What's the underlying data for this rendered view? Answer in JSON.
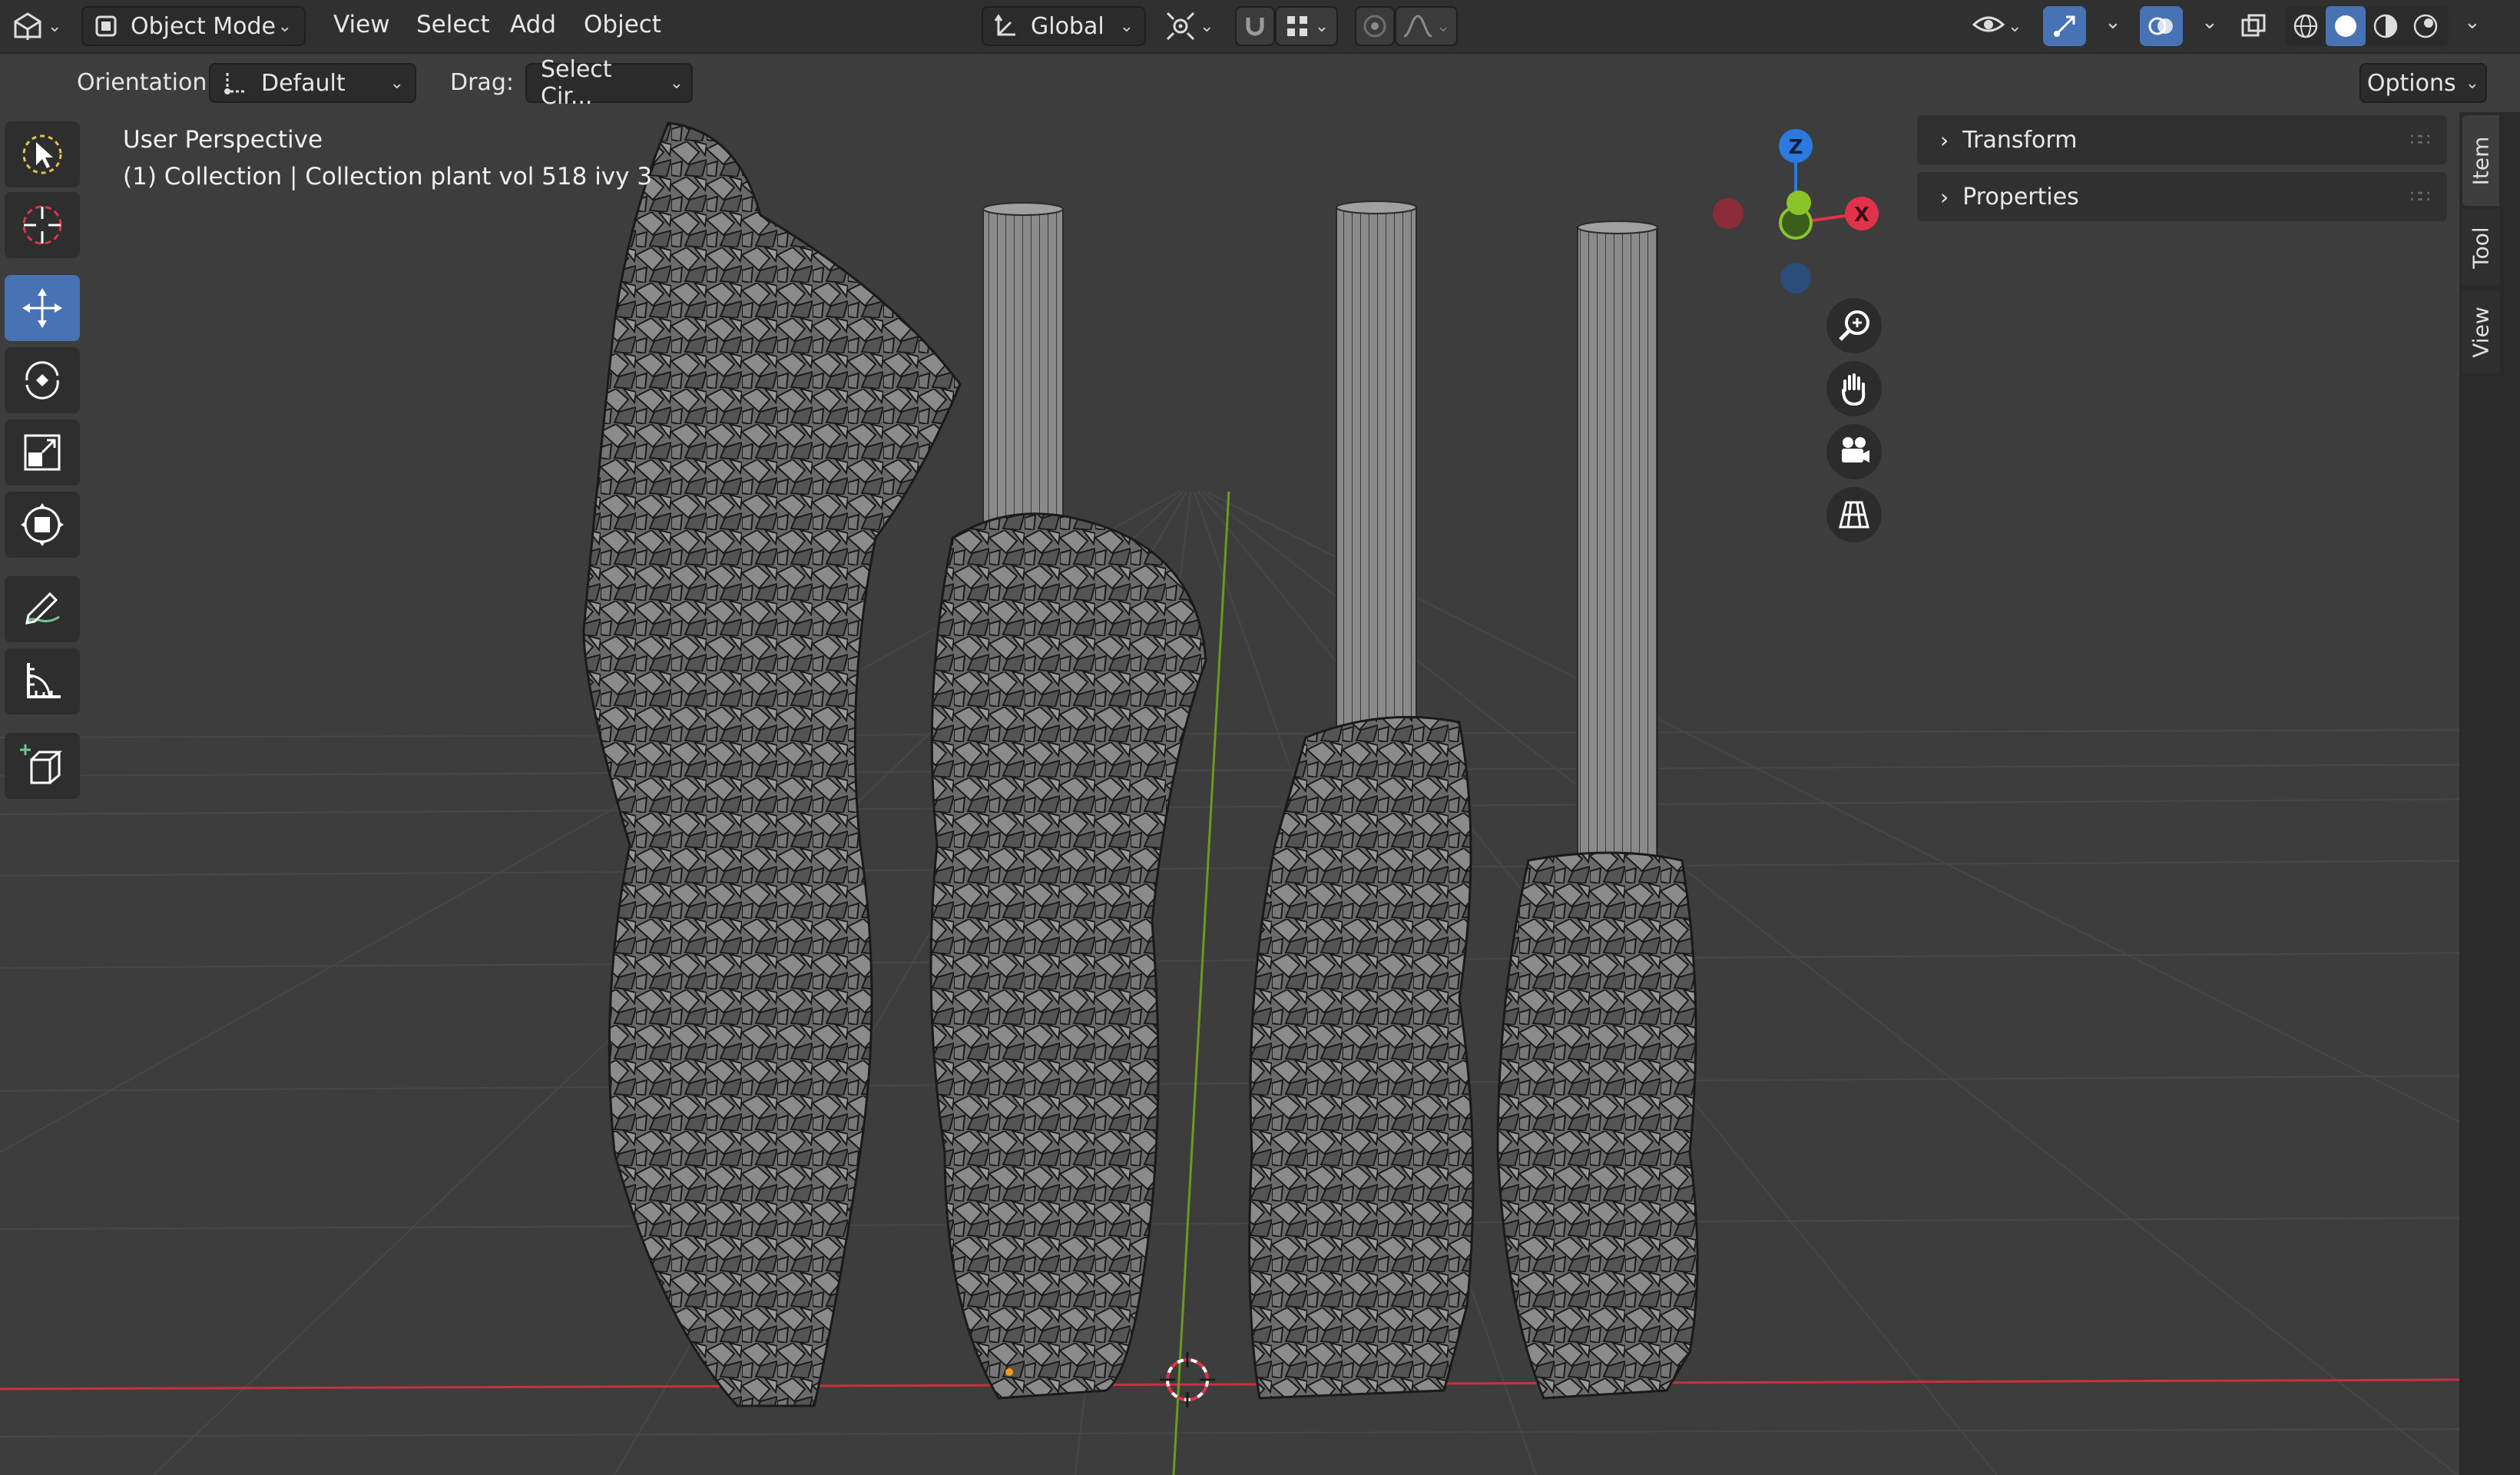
{
  "header": {
    "editor_type_icon": "3d-viewport-icon",
    "mode": {
      "label": "Object Mode",
      "icon": "object-mode-icon"
    },
    "menus": [
      "View",
      "Select",
      "Add",
      "Object"
    ],
    "transform_orientation": {
      "label": "Global",
      "icon": "transform-orientation-icon"
    },
    "pivot_icon": "pivot-point-icon",
    "snap_icon": "magnet-icon",
    "snap_target_icon": "snap-grid-icon",
    "proportional_icon": "proportional-edit-icon",
    "falloff_icon": "falloff-curve-icon",
    "visibility_icon": "eye-visibility-icon",
    "gizmo_icon": "gizmo-icon",
    "overlay_icon": "overlay-icon",
    "xray_icon": "xray-icon",
    "shading_modes": [
      "wireframe",
      "solid",
      "material-preview",
      "rendered"
    ],
    "active_shading": "solid"
  },
  "tool_header": {
    "orientation_label": "Orientation:",
    "orientation_value": "Default",
    "drag_label": "Drag:",
    "drag_value": "Select Cir...",
    "options_label": "Options"
  },
  "toolbar": {
    "tools": [
      {
        "name": "select-box-tool",
        "active": false
      },
      {
        "name": "cursor-tool",
        "active": false
      },
      {
        "name": "move-tool",
        "active": true
      },
      {
        "name": "rotate-tool",
        "active": false
      },
      {
        "name": "scale-tool",
        "active": false
      },
      {
        "name": "transform-tool",
        "active": false
      },
      {
        "name": "annotate-tool",
        "active": false
      },
      {
        "name": "measure-tool",
        "active": false
      },
      {
        "name": "add-cube-tool",
        "active": false
      }
    ]
  },
  "viewport": {
    "view_name": "User Perspective",
    "collection_info": "(1) Collection | Collection plant vol 518 ivy 3",
    "axis_x_color": "#c8313e",
    "axis_y_color": "#6b9a1f",
    "grid_color": "#4a4a4a",
    "bg_color": "#3d3d3d"
  },
  "gizmo": {
    "z_label": "Z",
    "x_label": "X",
    "x_color": "#e0334a",
    "y_color": "#8bc42a",
    "z_color": "#2c7ae0",
    "nav_buttons": [
      "zoom-icon",
      "hand-pan-icon",
      "camera-icon",
      "ortho-grid-icon"
    ]
  },
  "sidebar": {
    "panels": [
      "Transform",
      "Properties"
    ],
    "tabs": [
      "Item",
      "Tool",
      "View"
    ],
    "active_tab": "Item"
  }
}
